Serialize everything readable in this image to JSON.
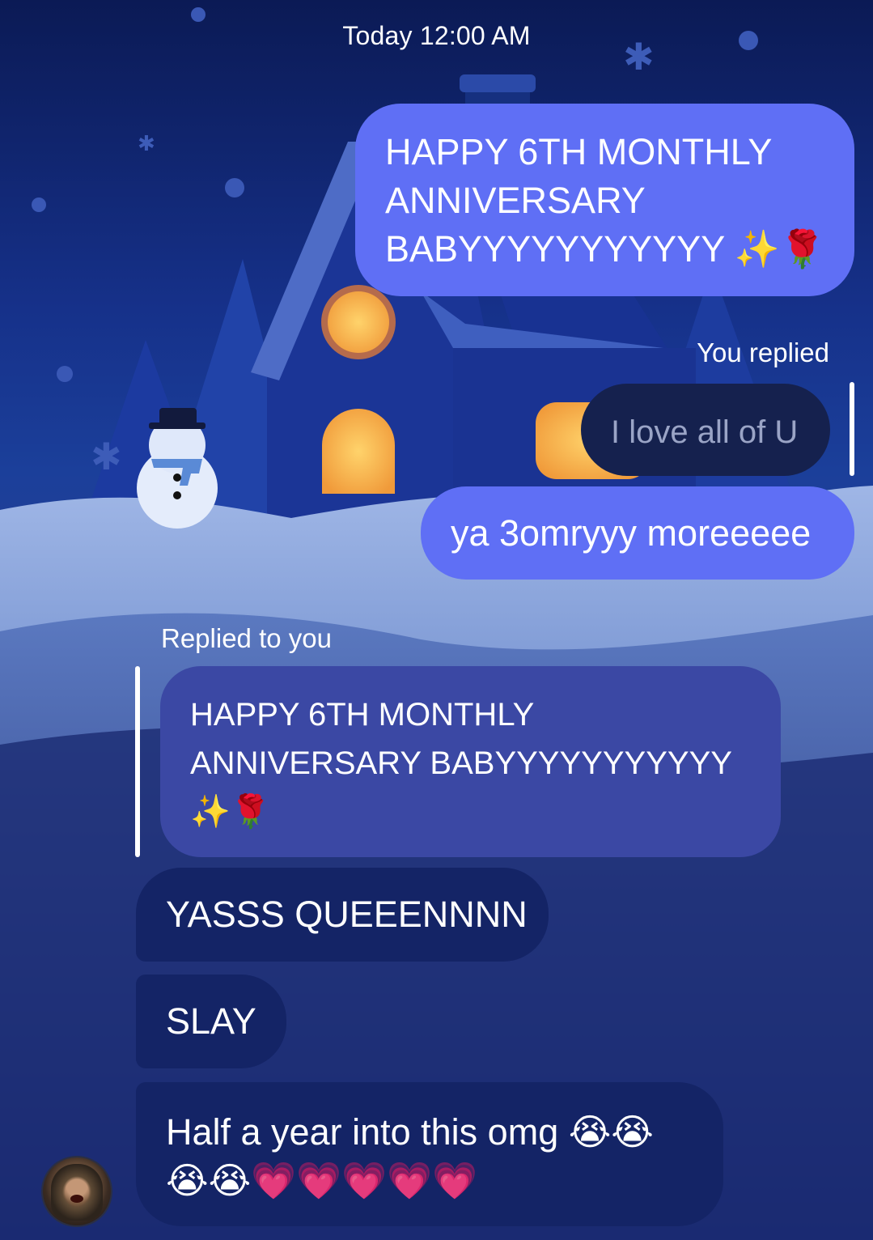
{
  "chat": {
    "timestamp": "Today 12:00 AM",
    "messages": [
      {
        "id": "m1",
        "direction": "outgoing",
        "text": "HAPPY 6TH MONTHLY ANNIVERSARY BABYYYYYYYYYYY ✨🌹",
        "lines": [
          "HAPPY 6TH MONTHLY",
          "ANNIVERSARY",
          "BABYYYYYYYYYYY ✨🌹"
        ]
      },
      {
        "id": "m2",
        "direction": "outgoing",
        "reply_label": "You replied",
        "quoted_text": "I love all of U",
        "text": "ya 3omryyy moreeeee"
      },
      {
        "id": "m3",
        "direction": "incoming",
        "reply_label": "Replied to you",
        "quoted_lines": [
          "HAPPY 6TH MONTHLY",
          "ANNIVERSARY BABYYYYYYYYYYY",
          "✨🌹"
        ],
        "text": "YASSS QUEEENNNN"
      },
      {
        "id": "m4",
        "direction": "incoming",
        "text": "SLAY"
      },
      {
        "id": "m5",
        "direction": "incoming",
        "lines": [
          "Half a year into this omg 😭😭",
          "😭😭💗💗💗💗💗"
        ]
      }
    ],
    "avatar": {
      "icon": "contact-avatar"
    }
  },
  "colors": {
    "outgoing_bubble": "#5f6ff5",
    "incoming_bubble": "#142466",
    "quoted_bubble": "#3b48a4",
    "reply_reference_bubble": "#15214e"
  }
}
